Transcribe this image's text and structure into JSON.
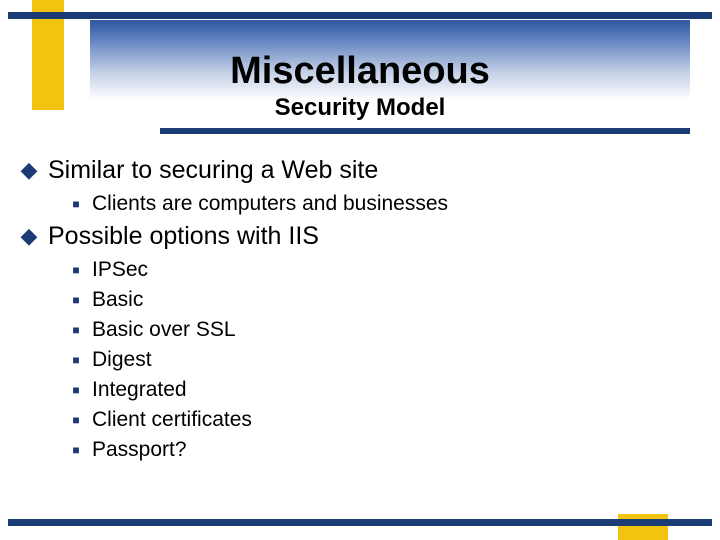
{
  "title": "Miscellaneous",
  "subtitle": "Security Model",
  "bullets": [
    {
      "text": "Similar to securing a Web site",
      "children": [
        {
          "text": "Clients are computers and businesses"
        }
      ]
    },
    {
      "text": "Possible options with IIS",
      "children": [
        {
          "text": "IPSec"
        },
        {
          "text": "Basic"
        },
        {
          "text": "Basic over SSL"
        },
        {
          "text": "Digest"
        },
        {
          "text": "Integrated"
        },
        {
          "text": "Client certificates"
        },
        {
          "text": "Passport?"
        }
      ]
    }
  ]
}
